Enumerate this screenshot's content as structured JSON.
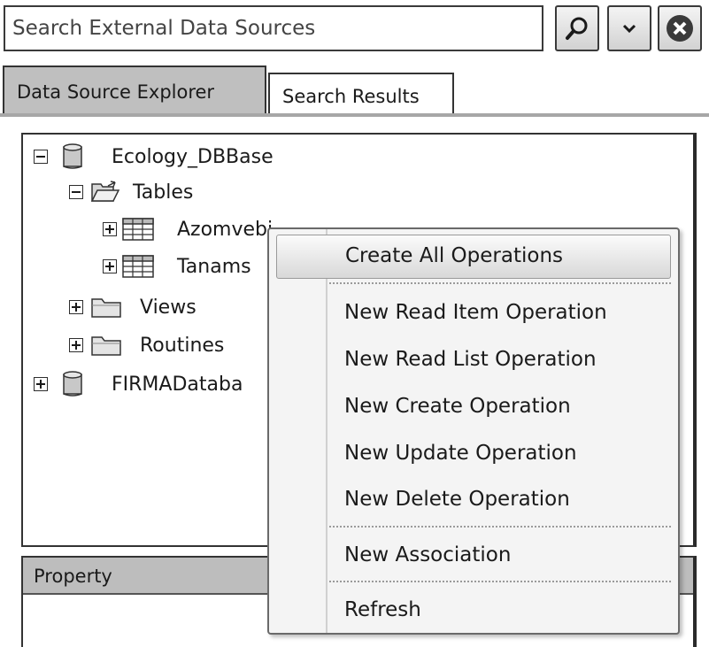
{
  "search": {
    "placeholder": "Search External Data Sources",
    "search_icon": "search-icon",
    "dropdown_icon": "chevron-down-icon",
    "clear_icon": "close-icon"
  },
  "tabs": [
    {
      "label": "Data Source Explorer",
      "active": true
    },
    {
      "label": "Search Results",
      "active": false
    }
  ],
  "tree": {
    "nodes": [
      {
        "label": "Ecology_DBBase",
        "icon": "database-icon",
        "expanded": true
      },
      {
        "label": "Tables",
        "icon": "open-folder-icon",
        "expanded": true
      },
      {
        "label": "Azomvebi",
        "icon": "table-icon",
        "expanded": false
      },
      {
        "label": "Tanams",
        "icon": "table-icon",
        "expanded": false
      },
      {
        "label": "Views",
        "icon": "folder-icon",
        "expanded": false
      },
      {
        "label": "Routines",
        "icon": "folder-icon",
        "expanded": false
      },
      {
        "label": "FIRMADataba",
        "icon": "database-icon",
        "expanded": false
      }
    ]
  },
  "property_panel": {
    "header": "Property"
  },
  "context_menu": {
    "items": [
      {
        "label": "Create All Operations",
        "highlighted": true
      },
      {
        "label": "New Read Item Operation"
      },
      {
        "label": "New Read List Operation"
      },
      {
        "label": "New Create Operation"
      },
      {
        "label": "New Update Operation"
      },
      {
        "label": "New Delete Operation"
      },
      {
        "label": "New Association"
      },
      {
        "label": "Refresh"
      }
    ]
  },
  "colors": {
    "active_tab": "#bfbfbf",
    "menu_background": "#f4f4f4",
    "menu_highlight": "#d8d8d8",
    "border": "#333333"
  }
}
